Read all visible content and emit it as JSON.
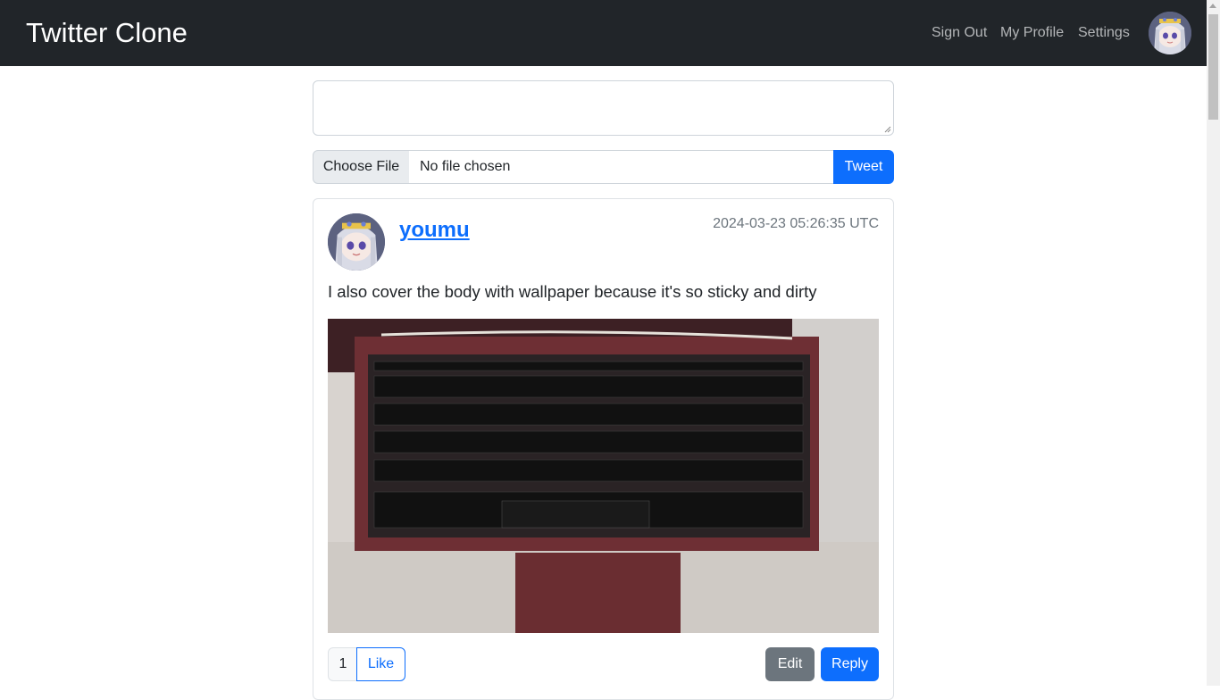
{
  "navbar": {
    "brand": "Twitter Clone",
    "links": [
      "Sign Out",
      "My Profile",
      "Settings"
    ]
  },
  "compose": {
    "textarea_value": "",
    "choose_file_label": "Choose File",
    "file_status": "No file chosen",
    "tweet_label": "Tweet"
  },
  "post": {
    "username": "youmu",
    "timestamp": "2024-03-23 05:26:35 UTC",
    "text": "I also cover the body with wallpaper because it's so sticky and dirty",
    "image_subject": "laptop keyboard photo",
    "like_count": "1",
    "like_label": "Like",
    "edit_label": "Edit",
    "reply_label": "Reply"
  },
  "colors": {
    "navbar_bg": "#212529",
    "primary": "#0d6efd",
    "secondary": "#6c757d"
  }
}
